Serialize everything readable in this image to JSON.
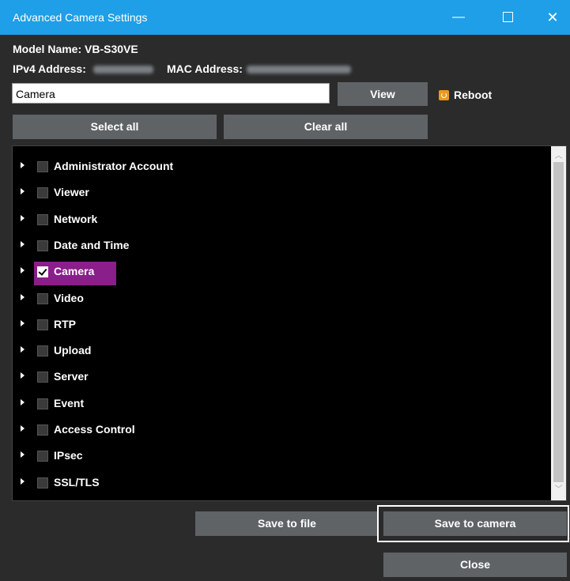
{
  "window": {
    "title": "Advanced Camera Settings",
    "minimize_glyph": "—",
    "close_glyph": "✕"
  },
  "info": {
    "model_label": "Model Name: VB-S30VE",
    "ipv4_label": "IPv4 Address:",
    "mac_label": "MAC Address:"
  },
  "filter": {
    "value": "Camera"
  },
  "buttons": {
    "view": "View",
    "reboot": "Reboot",
    "select_all": "Select all",
    "clear_all": "Clear all",
    "save_to_file": "Save to file",
    "save_to_camera": "Save to camera",
    "close": "Close"
  },
  "tree": {
    "items": [
      {
        "label": "Administrator Account",
        "checked": false
      },
      {
        "label": "Viewer",
        "checked": false
      },
      {
        "label": "Network",
        "checked": false
      },
      {
        "label": "Date and Time",
        "checked": false
      },
      {
        "label": "Camera",
        "checked": true,
        "selected": true
      },
      {
        "label": "Video",
        "checked": false
      },
      {
        "label": "RTP",
        "checked": false
      },
      {
        "label": "Upload",
        "checked": false
      },
      {
        "label": "Server",
        "checked": false
      },
      {
        "label": "Event",
        "checked": false
      },
      {
        "label": "Access Control",
        "checked": false
      },
      {
        "label": "IPsec",
        "checked": false
      },
      {
        "label": "SSL/TLS",
        "checked": false
      }
    ]
  },
  "colors": {
    "titlebar": "#1e9fe8",
    "selection": "#8a1e8a",
    "reboot_icon": "#e89a20"
  }
}
